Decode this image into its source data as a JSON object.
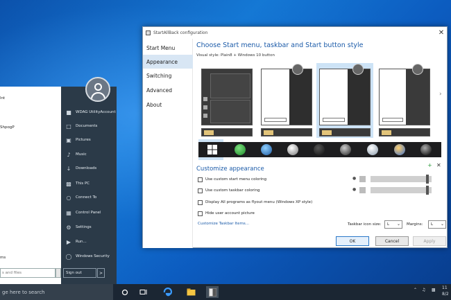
{
  "start_menu": {
    "programs": [
      "lnt",
      "ShpogP",
      "ms"
    ],
    "search_placeholder": "s and files",
    "right_items": [
      {
        "label": "WDAG UtilityAccount",
        "icon": "user-icon"
      },
      {
        "label": "Documents",
        "icon": "documents-icon"
      },
      {
        "label": "Pictures",
        "icon": "pictures-icon"
      },
      {
        "label": "Music",
        "icon": "music-icon"
      },
      {
        "label": "Downloads",
        "icon": "downloads-icon"
      },
      {
        "label": "This PC",
        "icon": "computer-icon"
      },
      {
        "label": "Connect To",
        "icon": "connect-icon"
      },
      {
        "label": "Control Panel",
        "icon": "control-panel-icon"
      },
      {
        "label": "Settings",
        "icon": "gear-icon"
      },
      {
        "label": "Run...",
        "icon": "run-icon"
      },
      {
        "label": "Windows Security",
        "icon": "shield-icon"
      }
    ],
    "signout_label": "Sign out",
    "signout_arrow": ">"
  },
  "taskbar": {
    "search_text": "ge here to search",
    "clock_time": "11",
    "clock_date": "8/2"
  },
  "window": {
    "title": "StartAllBack configuration",
    "close": "✕",
    "nav": [
      "Start Menu",
      "Appearance",
      "Switching",
      "Advanced",
      "About"
    ],
    "active_nav": "Appearance",
    "heading": "Choose Start menu, taskbar and Start button style",
    "visual_style": "Visual style: Plain8 + Windows 10 button",
    "customize_title": "Customize appearance",
    "plus": "+",
    "x": "✕",
    "checkboxes": [
      {
        "label": "Use custom start menu coloring",
        "checked": false
      },
      {
        "label": "Use custom taskbar coloring",
        "checked": false
      },
      {
        "label": "Display All programs as flyout menu (Windows XP style)",
        "checked": false
      },
      {
        "label": "Hide user account picture",
        "checked": false
      }
    ],
    "link": "Customize Taskbar Items...",
    "taskbar_icon_size_label": "Taskbar icon size:",
    "taskbar_icon_size_value": "L",
    "margins_label": "Margins:",
    "margins_value": "L",
    "buttons": {
      "ok": "OK",
      "cancel": "Cancel",
      "apply": "Apply"
    }
  },
  "colors": {
    "accent": "#1a5aa8",
    "start_menu_bg": "#2b3a48",
    "taskbar_bg": "#1b2633",
    "selection": "#cde3f6"
  }
}
